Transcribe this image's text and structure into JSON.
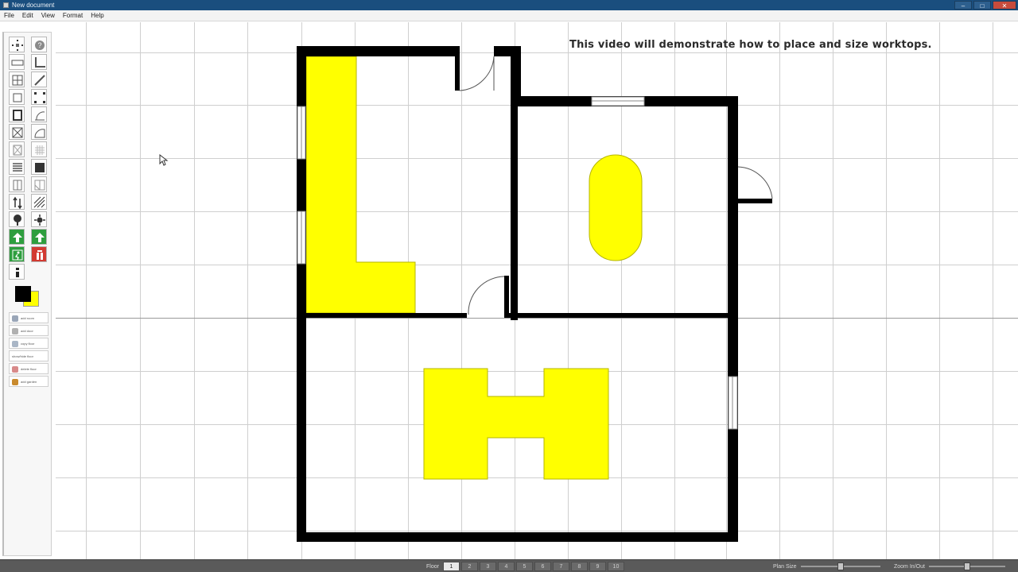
{
  "window": {
    "title": "New document",
    "controls": [
      "–",
      "□",
      "✕"
    ]
  },
  "menu": [
    "File",
    "Edit",
    "View",
    "Format",
    "Help"
  ],
  "toolbox": {
    "tools": [
      "select-tool",
      "help-tool",
      "wall-tool",
      "corner-wall-tool",
      "window-tool",
      "diagonal-wall-tool",
      "room-tool",
      "node-tool",
      "door-tool",
      "arc-tool",
      "cross-tool",
      "curve-tool",
      "stairs-tool",
      "fill-tool",
      "column-tool",
      "split-tool",
      "lift-tool",
      "hatch-tool",
      "tree-tool",
      "light-tool",
      "exit-up-tool",
      "exit-arrow-tool",
      "emergency-exit-tool",
      "fire-extinguisher-tool",
      "info-tool"
    ],
    "colors": {
      "primary": "#000000",
      "secondary": "#ffff00"
    },
    "actions": [
      {
        "label": "add room",
        "icon_color": "#9aa6b8"
      },
      {
        "label": "add door",
        "icon_color": "#b0b0b0"
      },
      {
        "label": "copy floor",
        "icon_color": "#a9b6c6"
      },
      {
        "label": "show/hide floor",
        "icon_color": "#ffffff"
      },
      {
        "label": "delete floor",
        "icon_color": "#d88a8a"
      },
      {
        "label": "add garden",
        "icon_color": "#c98a2e"
      }
    ]
  },
  "canvas": {
    "caption": "This video will demonstrate how to place and size worktops.",
    "worktop_color": "#ffff00",
    "wall_color": "#000000"
  },
  "statusbar": {
    "floor_label": "Floor",
    "floors": [
      "1",
      "2",
      "3",
      "4",
      "5",
      "6",
      "7",
      "8",
      "9",
      "10"
    ],
    "active_floor": "1",
    "plan_size_label": "Plan Size",
    "plan_size_value": 0.5,
    "zoom_label": "Zoom In/Out",
    "zoom_value": 0.5
  }
}
